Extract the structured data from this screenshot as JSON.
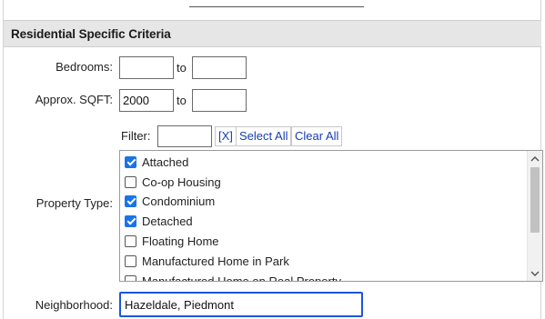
{
  "section": {
    "title": "Residential Specific Criteria"
  },
  "bedrooms": {
    "label": "Bedrooms:",
    "min": "",
    "max": "",
    "to": "to"
  },
  "sqft": {
    "label": "Approx. SQFT:",
    "min": "2000",
    "max": "",
    "to": "to"
  },
  "filter": {
    "label": "Filter:",
    "value": "",
    "clear_x": "[X]",
    "select_all": "Select All",
    "clear_all": "Clear All"
  },
  "property_type": {
    "label": "Property Type:",
    "options": [
      {
        "label": "Attached",
        "checked": true
      },
      {
        "label": "Co-op Housing",
        "checked": false
      },
      {
        "label": "Condominium",
        "checked": true
      },
      {
        "label": "Detached",
        "checked": true
      },
      {
        "label": "Floating Home",
        "checked": false
      },
      {
        "label": "Manufactured Home in Park",
        "checked": false
      },
      {
        "label": "Manufactured Home on Real Property",
        "checked": false
      }
    ]
  },
  "neighborhood": {
    "label": "Neighborhood:",
    "value": "Hazeldale, Piedmont"
  },
  "colors": {
    "checkbox_checked": "#1a73e8",
    "link": "#1a3bb3",
    "focus_border": "#1a56db",
    "section_bg": "#e6e6e6"
  },
  "icons": {
    "scroll_up": "chevron-up-icon",
    "scroll_down": "chevron-down-icon"
  }
}
